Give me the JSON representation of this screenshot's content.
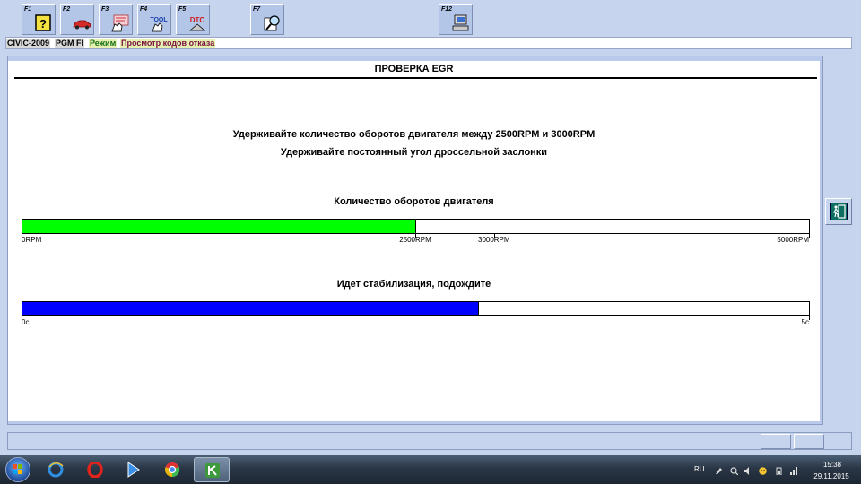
{
  "toolbar": {
    "buttons": [
      {
        "key": "F1",
        "icon": "help-question-icon"
      },
      {
        "key": "F2",
        "icon": "car-icon"
      },
      {
        "key": "F3",
        "icon": "data-list-hand-icon"
      },
      {
        "key": "F4",
        "icon": "tool-hand-icon",
        "label": "TOOL"
      },
      {
        "key": "F5",
        "icon": "dtc-icon",
        "label": "DTC"
      },
      {
        "key": "F7",
        "icon": "magnifier-document-icon"
      },
      {
        "key": "F12",
        "icon": "computer-icon"
      }
    ]
  },
  "status_line": {
    "model": "CIVIC-2009",
    "system": "PGM FI",
    "mode_label": "Режим",
    "mode_value": "Просмотр кодов отказа"
  },
  "panel": {
    "title": "ПРОВЕРКА EGR",
    "instruction_1": "Удерживайте количество оборотов двигателя между 2500RPM и 3000RPM",
    "instruction_2": "Удерживайте постоянный угол дроссельной заслонки",
    "rpm": {
      "label": "Количество оборотов двигателя",
      "min": 0,
      "max": 5000,
      "current": 2500,
      "color": "#00ff00",
      "ticks": [
        {
          "value": 0,
          "text": "0RPM"
        },
        {
          "value": 2500,
          "text": "2500RPM"
        },
        {
          "value": 3000,
          "text": "3000RPM"
        },
        {
          "value": 5000,
          "text": "5000RPM"
        }
      ]
    },
    "stabilization": {
      "label": "Идет стабилизация, подождите",
      "min": 0,
      "max": 5,
      "current": 2.9,
      "color": "#0000ff",
      "ticks": [
        {
          "value": 0,
          "text": "0c"
        },
        {
          "value": 5,
          "text": "5c"
        }
      ]
    }
  },
  "exit_button": {
    "icon": "exit-door-icon"
  },
  "taskbar": {
    "apps": [
      {
        "name": "internet-explorer-icon",
        "color": "#2f8fe0"
      },
      {
        "name": "opera-icon",
        "color": "#e0241b"
      },
      {
        "name": "media-player-icon",
        "color": "#3b8fe6"
      },
      {
        "name": "chrome-icon",
        "color": "#e8b30f"
      },
      {
        "name": "diagnostic-app-icon",
        "color": "#3c9a3c"
      }
    ],
    "language": "RU",
    "time": "15:38",
    "date": "29.11.2015"
  }
}
